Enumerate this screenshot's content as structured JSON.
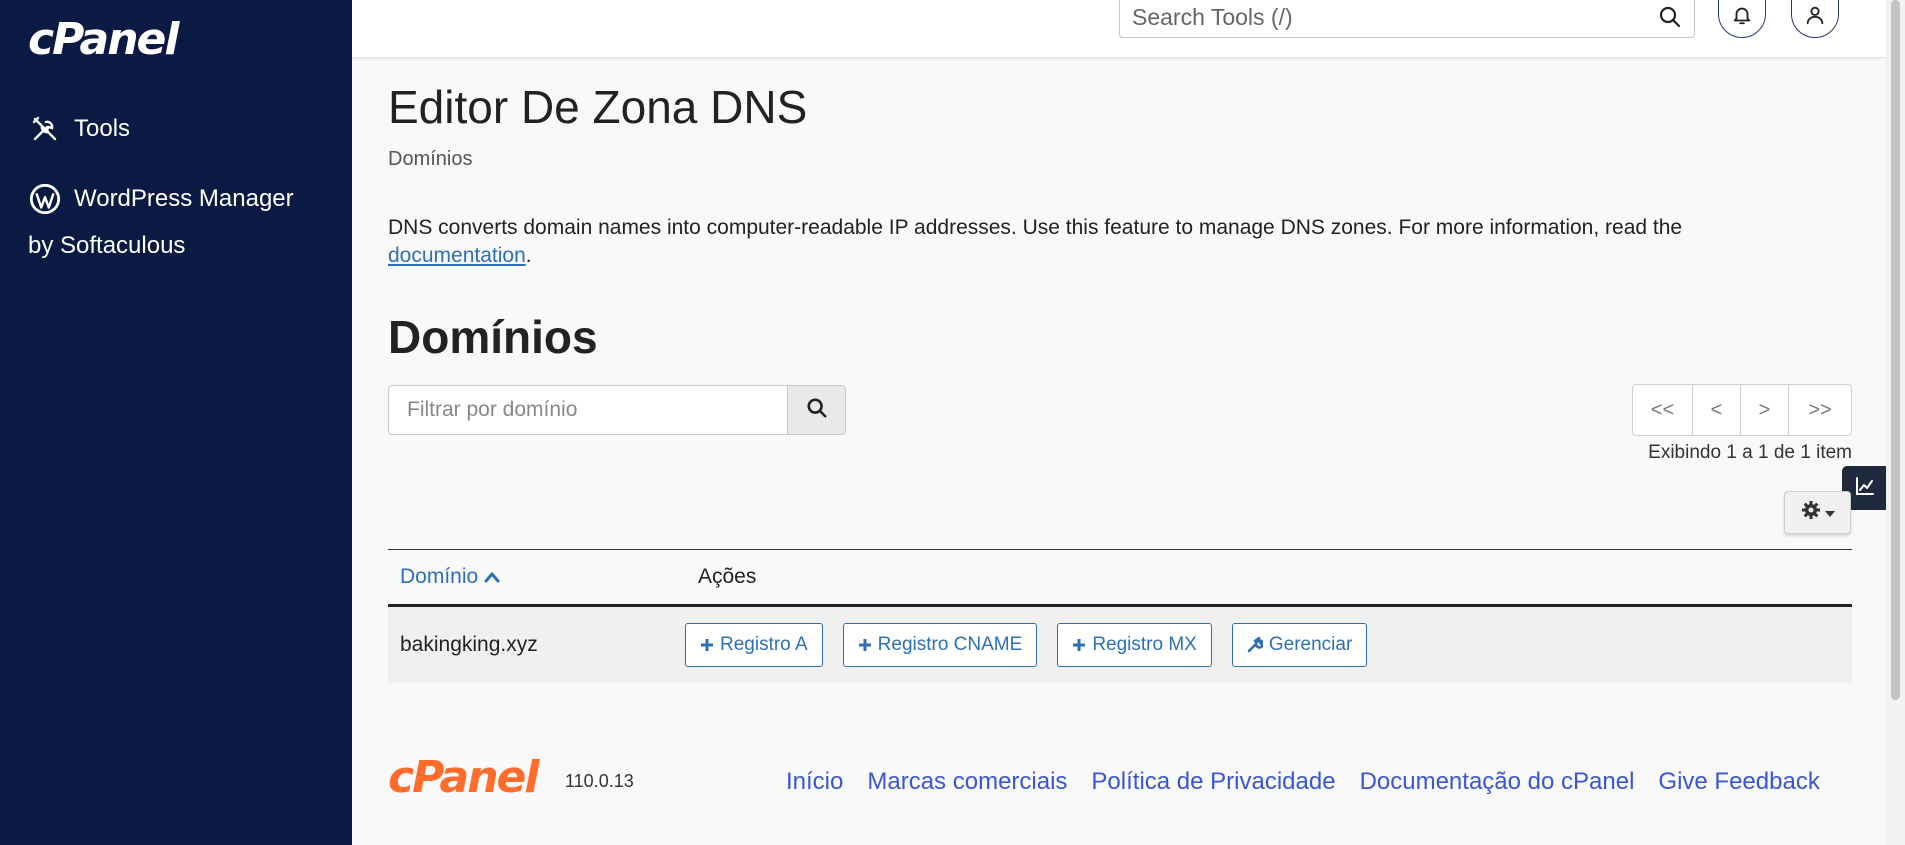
{
  "sidebar": {
    "logo": "cPanel",
    "items": [
      {
        "label": "Tools",
        "icon": "tools-icon"
      },
      {
        "label": "WordPress Manager",
        "sub": "by Softaculous",
        "icon": "wordpress-icon"
      }
    ]
  },
  "header": {
    "search_placeholder": "Search Tools (/)"
  },
  "page": {
    "title": "Editor De Zona DNS",
    "breadcrumb": "Domínios",
    "description_text": "DNS converts domain names into computer-readable IP addresses. Use this feature to manage DNS zones. For more information, read the ",
    "description_link": "documentation",
    "description_end": "."
  },
  "domains": {
    "section_title": "Domínios",
    "filter_placeholder": "Filtrar por domínio",
    "pager": {
      "first": "<<",
      "prev": "<",
      "next": ">",
      "last": ">>"
    },
    "showing": "Exibindo 1 a 1 de 1 item",
    "table": {
      "headers": {
        "domain": "Domínio",
        "actions": "Ações"
      },
      "rows": [
        {
          "domain": "bakingking.xyz",
          "actions": [
            "Registro A",
            "Registro CNAME",
            "Registro MX",
            "Gerenciar"
          ]
        }
      ]
    }
  },
  "footer": {
    "logo": "cPanel",
    "version": "110.0.13",
    "links": [
      "Início",
      "Marcas comerciais",
      "Política de Privacidade",
      "Documentação do cPanel",
      "Give Feedback"
    ]
  },
  "colors": {
    "sidebar_bg": "#0a1a42",
    "link": "#2f6fb6",
    "footer_link": "#3a56d4",
    "brand_orange": "#ff6c2c"
  }
}
